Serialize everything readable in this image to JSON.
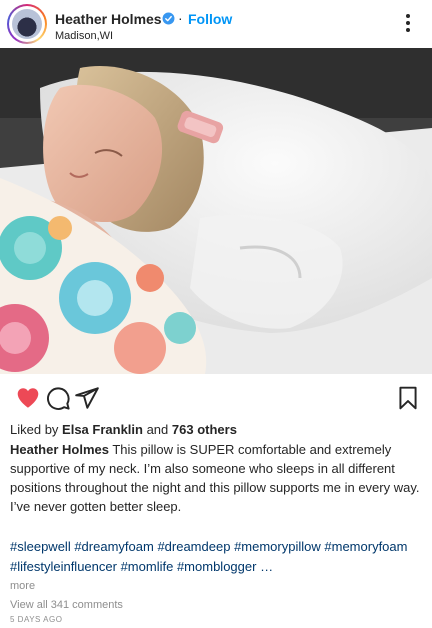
{
  "post": {
    "username": "Heather Holmes",
    "separator": "·",
    "follow_label": "Follow",
    "location": "Madison,WI",
    "likes": {
      "prefix": "Liked by ",
      "user": "Elsa Franklin",
      "middle": " and ",
      "count": "763 others"
    },
    "caption": {
      "author": "Heather Holmes",
      "text": " This pillow is SUPER comfortable and extremely supportive of my neck. I’m also someone who sleeps in all different positions throughout the night and this pillow supports me in every way. I’ve never gotten better sleep."
    },
    "hashtags": [
      "#sleepwell",
      "#dreamyfoam",
      "#dreamdeep",
      "#memorypillow",
      "#memoryfoam",
      "#lifestyleinfluencer",
      "#momlife",
      "#momblogger"
    ],
    "ellipsis": "…",
    "more_label": "more",
    "view_comments": "View all 341 comments",
    "timestamp": "5 DAYS AGO"
  },
  "icons": {
    "like": "heart-icon-filled",
    "comment": "comment-icon",
    "share": "share-icon",
    "save": "bookmark-icon",
    "options": "more-options-icon",
    "verified": "verified-badge-icon"
  },
  "colors": {
    "like": "#ed4956",
    "link": "#0095f6",
    "hashtag": "#00376b",
    "muted": "#8e8e8e",
    "verified": "#3897f0"
  }
}
